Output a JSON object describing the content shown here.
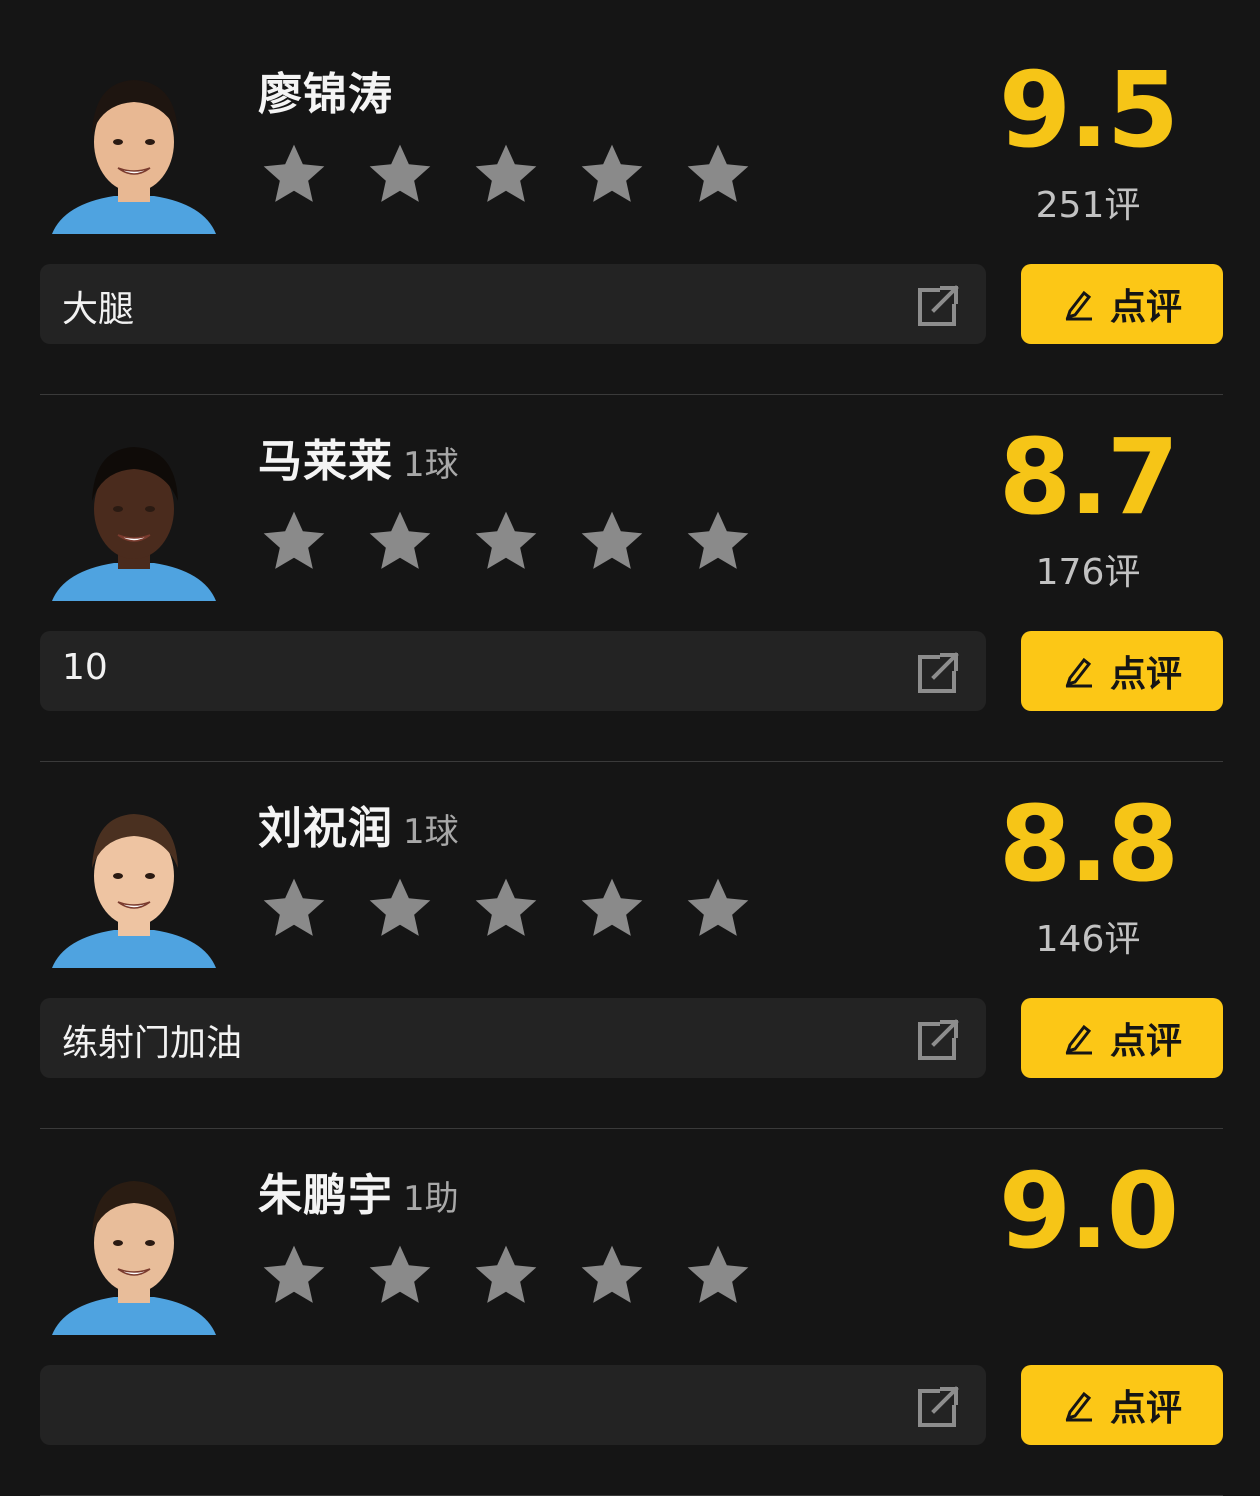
{
  "players": [
    {
      "name": "廖锦涛",
      "stat": "",
      "stars_max": 5,
      "score": "9.5",
      "votes": "251评",
      "comment": "大腿",
      "rate_label": "点评",
      "jersey_color": "#4fa3e0",
      "hair_color": "#1e1510",
      "skin_color": "#e8b893"
    },
    {
      "name": "马莱莱",
      "stat": "1球",
      "stars_max": 5,
      "score": "8.7",
      "votes": "176评",
      "comment": "10",
      "rate_label": "点评",
      "jersey_color": "#4fa3e0",
      "hair_color": "#0f0b08",
      "skin_color": "#4a2b1d"
    },
    {
      "name": "刘祝润",
      "stat": "1球",
      "stars_max": 5,
      "score": "8.8",
      "votes": "146评",
      "comment": "练射门加油",
      "rate_label": "点评",
      "jersey_color": "#4fa3e0",
      "hair_color": "#4a3020",
      "skin_color": "#eec4a2"
    },
    {
      "name": "朱鹏宇",
      "stat": "1助",
      "stars_max": 5,
      "score": "9.0",
      "votes": "",
      "comment": "",
      "rate_label": "点评",
      "jersey_color": "#4fa3e0",
      "hair_color": "#2a1c12",
      "skin_color": "#e8bd9a"
    }
  ],
  "colors": {
    "accent": "#f6c517",
    "button": "#fcc716",
    "star": "#8a8a8a",
    "background": "#151515",
    "input": "#232323"
  },
  "icons": {
    "star": "star-icon",
    "share": "external-share-icon",
    "pen": "pen-icon"
  }
}
